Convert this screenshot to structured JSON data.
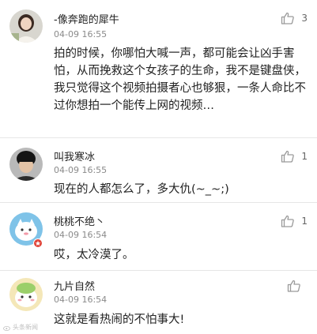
{
  "comments": [
    {
      "username": "-像奔跑的犀牛",
      "time": "04-09 16:55",
      "likes": "3",
      "text": "拍的时候，你哪怕大喊一声，都可能会让凶手害怕，从而挽救这个女孩子的生命，我不是键盘侠，我只觉得这个视频拍摄者心也够狠，一条人命比不过你想拍一个能传上网的视频…"
    },
    {
      "username": "叫我寒冰",
      "time": "04-09 16:55",
      "likes": "1",
      "text": "现在的人都怎么了，多大仇(~_~;)"
    },
    {
      "username": "桃桃不绝丶",
      "time": "04-09 16:54",
      "likes": "1",
      "text": "哎，太冷漠了。"
    },
    {
      "username": "九片自然",
      "time": "04-09 16:54",
      "likes": "",
      "text": "这就是看热闹的不怕事大!"
    }
  ],
  "watermark": "头条新闻",
  "colors": {
    "divider": "#e6e6e6",
    "meta": "#8a8a8a",
    "icon": "#9a9a9a"
  }
}
